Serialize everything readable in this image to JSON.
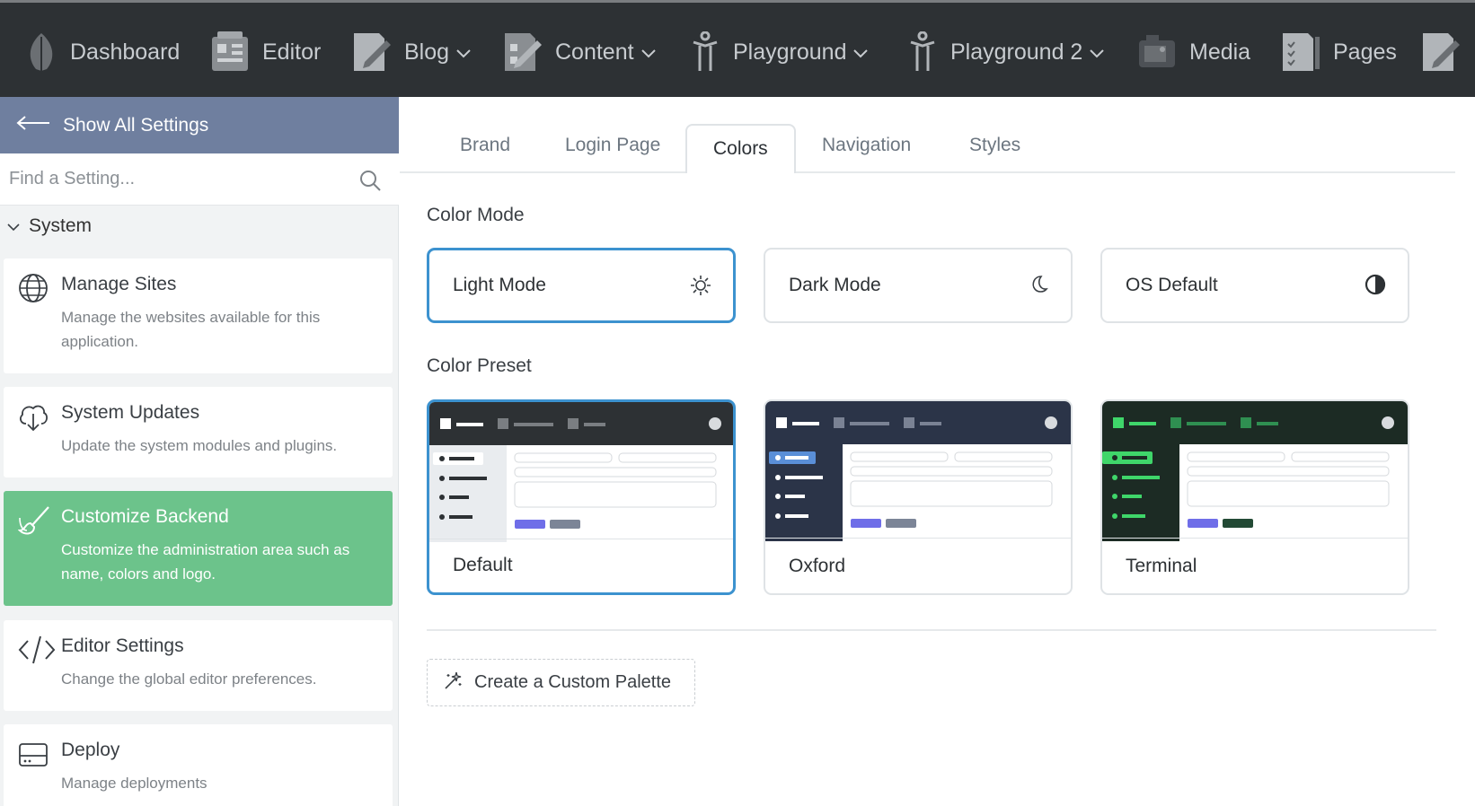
{
  "topnav": {
    "items": [
      {
        "label": "Dashboard",
        "icon": "leaf-icon",
        "has_dropdown": false
      },
      {
        "label": "Editor",
        "icon": "editor-icon",
        "has_dropdown": false
      },
      {
        "label": "Blog",
        "icon": "pencil-doc-icon",
        "has_dropdown": true
      },
      {
        "label": "Content",
        "icon": "content-doc-icon",
        "has_dropdown": true
      },
      {
        "label": "Playground",
        "icon": "figure-icon",
        "has_dropdown": true
      },
      {
        "label": "Playground 2",
        "icon": "figure-icon",
        "has_dropdown": true
      },
      {
        "label": "Media",
        "icon": "camera-icon",
        "has_dropdown": false
      },
      {
        "label": "Pages",
        "icon": "pages-icon",
        "has_dropdown": false
      }
    ]
  },
  "sidebar": {
    "back_label": "Show All Settings",
    "search_placeholder": "Find a Setting...",
    "section_title": "System",
    "items": [
      {
        "title": "Manage Sites",
        "desc": "Manage the websites available for this application.",
        "icon": "globe-icon"
      },
      {
        "title": "System Updates",
        "desc": "Update the system modules and plugins.",
        "icon": "cloud-download-icon"
      },
      {
        "title": "Customize Backend",
        "desc": "Customize the administration area such as name, colors and logo.",
        "icon": "brush-icon",
        "active": true
      },
      {
        "title": "Editor Settings",
        "desc": "Change the global editor preferences.",
        "icon": "code-icon"
      },
      {
        "title": "Deploy",
        "desc": "Manage deployments",
        "icon": "server-icon"
      }
    ]
  },
  "tabs": [
    {
      "label": "Brand"
    },
    {
      "label": "Login Page"
    },
    {
      "label": "Colors",
      "active": true
    },
    {
      "label": "Navigation"
    },
    {
      "label": "Styles"
    }
  ],
  "color_mode": {
    "label": "Color Mode",
    "options": [
      {
        "label": "Light Mode",
        "icon": "sun-gear-icon",
        "selected": true
      },
      {
        "label": "Dark Mode",
        "icon": "moon-icon"
      },
      {
        "label": "OS Default",
        "icon": "half-circle-icon"
      }
    ]
  },
  "color_preset": {
    "label": "Color Preset",
    "presets": [
      {
        "name": "Default",
        "selected": true,
        "colors": {
          "header": "#2d3134",
          "sidebar": "#e9ecef",
          "accent": "#ffffff",
          "button1": "#6f6ee8",
          "button2": "#7c8597"
        }
      },
      {
        "name": "Oxford",
        "colors": {
          "header": "#2b3448",
          "sidebar": "#2b3448",
          "accent": "#5a8fd8",
          "button1": "#6f6ee8",
          "button2": "#7c8597"
        }
      },
      {
        "name": "Terminal",
        "colors": {
          "header": "#1c2b24",
          "sidebar": "#1c2b24",
          "accent": "#3fd66a",
          "button1": "#6f6ee8",
          "button2": "#234a35"
        }
      }
    ]
  },
  "custom_palette_label": "Create a Custom Palette"
}
